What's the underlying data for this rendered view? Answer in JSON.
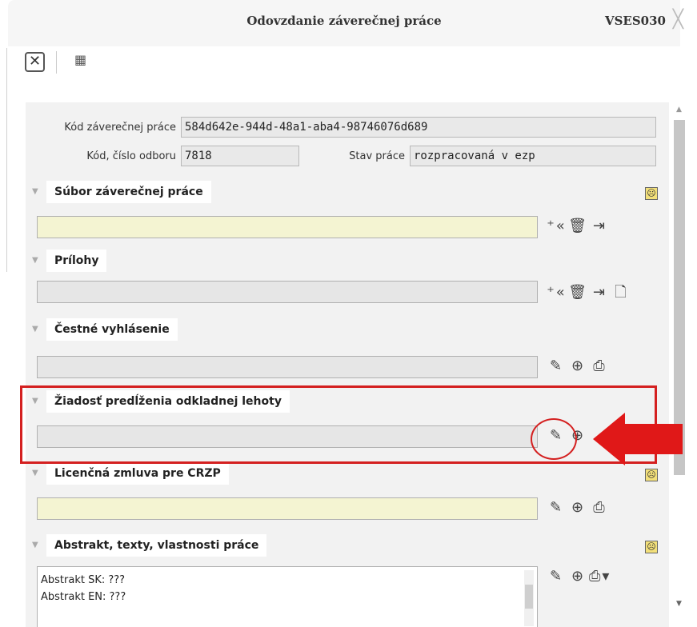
{
  "window": {
    "title": "Odovzdanie záverečnej práce",
    "code": "VSES030"
  },
  "fields": {
    "kod_prace_label": "Kód záverečnej práce",
    "kod_prace_value": "584d642e-944d-48a1-aba4-98746076d689",
    "kod_odboru_label": "Kód, číslo odboru",
    "kod_odboru_value": "7818",
    "stav_label": "Stav práce",
    "stav_value": "rozpracovaná v ezp"
  },
  "sections": [
    {
      "title": "Súbor záverečnej práce"
    },
    {
      "title": "Prílohy"
    },
    {
      "title": "Čestné vyhlásenie"
    },
    {
      "title": "Žiadosť predĺženia odkladnej lehoty"
    },
    {
      "title": "Licenčná zmluva pre CRZP"
    },
    {
      "title": "Abstrakt, texty, vlastnosti práce"
    }
  ],
  "abstract_lines": [
    "Abstrakt SK: ???",
    "Abstrakt EN: ???"
  ],
  "colors": {
    "highlight": "#d42020",
    "yellow_field": "#f4f4d2",
    "panel_bg": "#f2f2f2"
  }
}
